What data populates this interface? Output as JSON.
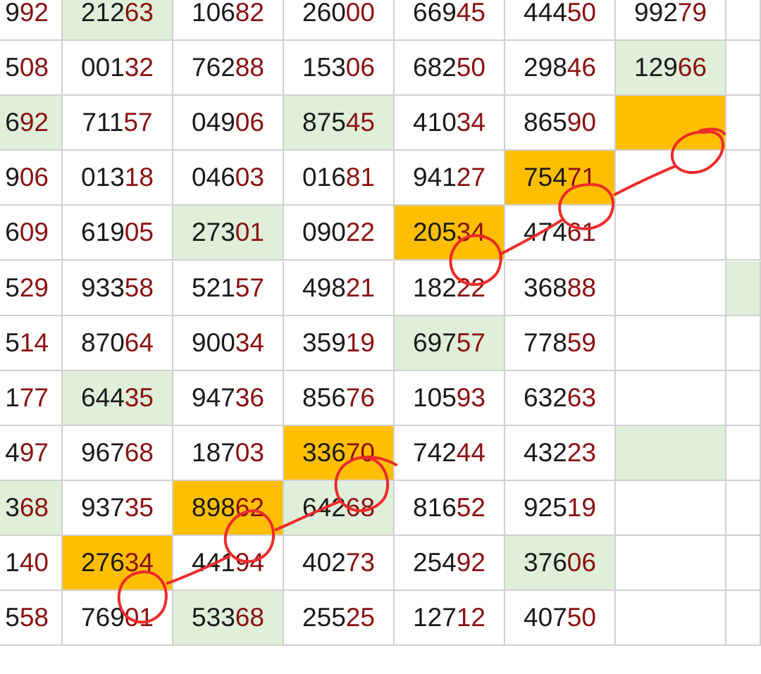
{
  "colors": {
    "highlight": "#ffbf00",
    "green_fill": "#dfefd9",
    "digit_dark": "#1a1a1a",
    "digit_red": "#8b1010",
    "annotation": "#ee2b2b",
    "gridline": "#d0d0d0"
  },
  "rows": [
    {
      "cells": [
        {
          "t": "992"
        },
        {
          "t": "21263",
          "f": "g"
        },
        {
          "t": "10682"
        },
        {
          "t": "26000"
        },
        {
          "t": "66945"
        },
        {
          "t": "44450"
        },
        {
          "t": "99279"
        },
        {
          "t": ""
        }
      ]
    },
    {
      "cells": [
        {
          "t": "508"
        },
        {
          "t": "00132"
        },
        {
          "t": "76288"
        },
        {
          "t": "15306"
        },
        {
          "t": "68250"
        },
        {
          "t": "29846"
        },
        {
          "t": "12966",
          "f": "g"
        },
        {
          "t": ""
        }
      ]
    },
    {
      "cells": [
        {
          "t": "692",
          "f": "g"
        },
        {
          "t": "71157"
        },
        {
          "t": "04906"
        },
        {
          "t": "87545",
          "f": "g"
        },
        {
          "t": "41034"
        },
        {
          "t": "86590"
        },
        {
          "t": "",
          "f": "y"
        },
        {
          "t": ""
        }
      ]
    },
    {
      "cells": [
        {
          "t": "906"
        },
        {
          "t": "01318"
        },
        {
          "t": "04603"
        },
        {
          "t": "01681"
        },
        {
          "t": "94127"
        },
        {
          "t": "75471",
          "f": "y"
        },
        {
          "t": ""
        },
        {
          "t": ""
        }
      ]
    },
    {
      "cells": [
        {
          "t": "609"
        },
        {
          "t": "61905"
        },
        {
          "t": "27301",
          "f": "g"
        },
        {
          "t": "09022"
        },
        {
          "t": "20534",
          "f": "y"
        },
        {
          "t": "47461"
        },
        {
          "t": ""
        },
        {
          "t": ""
        }
      ]
    },
    {
      "cells": [
        {
          "t": "529"
        },
        {
          "t": "93358"
        },
        {
          "t": "52157"
        },
        {
          "t": "49821"
        },
        {
          "t": "18222"
        },
        {
          "t": "36888"
        },
        {
          "t": ""
        },
        {
          "t": "",
          "f": "g"
        }
      ]
    },
    {
      "cells": [
        {
          "t": "514"
        },
        {
          "t": "87064"
        },
        {
          "t": "90034"
        },
        {
          "t": "35919"
        },
        {
          "t": "69757",
          "f": "g"
        },
        {
          "t": "77859"
        },
        {
          "t": ""
        },
        {
          "t": ""
        }
      ]
    },
    {
      "cells": [
        {
          "t": "177"
        },
        {
          "t": "64435",
          "f": "g"
        },
        {
          "t": "94736"
        },
        {
          "t": "85676"
        },
        {
          "t": "10593"
        },
        {
          "t": "63263"
        },
        {
          "t": ""
        },
        {
          "t": ""
        }
      ]
    },
    {
      "cells": [
        {
          "t": "497"
        },
        {
          "t": "96768"
        },
        {
          "t": "18703"
        },
        {
          "t": "33670",
          "f": "y"
        },
        {
          "t": "74244"
        },
        {
          "t": "43223"
        },
        {
          "t": "",
          "f": "g"
        },
        {
          "t": ""
        }
      ]
    },
    {
      "cells": [
        {
          "t": "368",
          "f": "g"
        },
        {
          "t": "93735"
        },
        {
          "t": "89862",
          "f": "y"
        },
        {
          "t": "64268",
          "f": "g"
        },
        {
          "t": "81652"
        },
        {
          "t": "92519"
        },
        {
          "t": ""
        },
        {
          "t": ""
        }
      ]
    },
    {
      "cells": [
        {
          "t": "140"
        },
        {
          "t": "27634",
          "f": "y"
        },
        {
          "t": "44194"
        },
        {
          "t": "40273"
        },
        {
          "t": "25492"
        },
        {
          "t": "37606",
          "f": "g"
        },
        {
          "t": ""
        },
        {
          "t": ""
        }
      ]
    },
    {
      "cells": [
        {
          "t": "558"
        },
        {
          "t": "76901"
        },
        {
          "t": "53368",
          "f": "g"
        },
        {
          "t": "25525"
        },
        {
          "t": "12712"
        },
        {
          "t": "40750"
        },
        {
          "t": ""
        },
        {
          "t": ""
        }
      ]
    }
  ]
}
